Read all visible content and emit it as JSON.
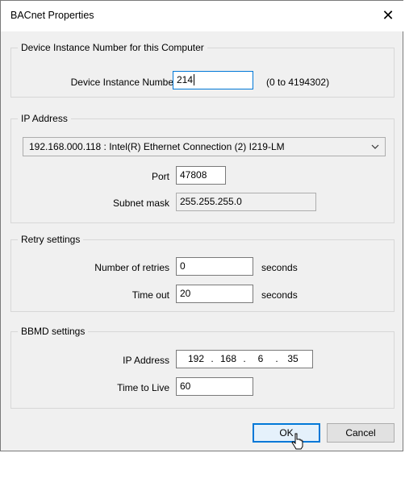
{
  "window": {
    "title": "BACnet Properties",
    "close_glyph": "✕",
    "close_icon": "close-icon"
  },
  "device_group": {
    "legend": "Device Instance Number for this Computer",
    "instance_label": "Device Instance Number",
    "instance_value": "214",
    "range_hint": "(0 to 4194302)"
  },
  "ip_group": {
    "legend": "IP Address",
    "adapter_selected": "192.168.000.118 : Intel(R) Ethernet Connection (2) I219-LM",
    "port_label": "Port",
    "port_value": "47808",
    "subnet_label": "Subnet mask",
    "subnet_value": "255.255.255.0"
  },
  "retry_group": {
    "legend": "Retry settings",
    "retries_label": "Number of retries",
    "retries_value": "0",
    "retries_unit": "seconds",
    "timeout_label": "Time out",
    "timeout_value": "20",
    "timeout_unit": "seconds"
  },
  "bbmd_group": {
    "legend": "BBMD settings",
    "ip_label": "IP Address",
    "ip_octets": [
      "192",
      "168",
      "6",
      "35"
    ],
    "ip_dots": [
      ".",
      ".",
      "."
    ],
    "ttl_label": "Time to Live",
    "ttl_value": "60"
  },
  "buttons": {
    "ok": "OK",
    "cancel": "Cancel"
  },
  "colors": {
    "accent": "#0078d7",
    "dialog_bg": "#f0f0f0",
    "group_border": "#d7d7d7"
  }
}
